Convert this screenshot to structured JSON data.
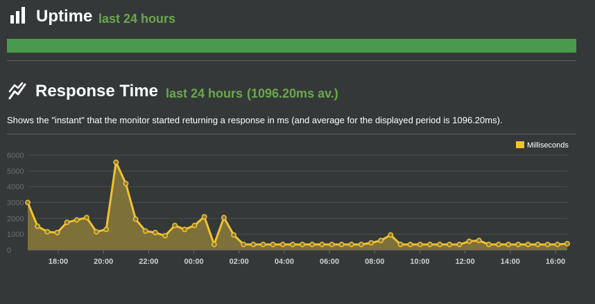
{
  "uptime": {
    "title": "Uptime",
    "period": "last 24 hours",
    "bar_color": "#4a9a4d",
    "icon": "bar-chart-icon"
  },
  "response": {
    "title": "Response Time",
    "period": "last 24 hours",
    "average": "(1096.20ms av.)",
    "description": "Shows the \"instant\" that the monitor started returning a response in ms (and average for the displayed period is 1096.20ms).",
    "icon": "line-chart-icon"
  },
  "colors": {
    "background": "#353838",
    "accent": "#6aa84f",
    "line": "#f1c232",
    "fill": "#8a7a3a"
  },
  "chart_data": {
    "type": "area",
    "xlabel": "",
    "ylabel": "",
    "ylim": [
      0,
      6000
    ],
    "y_ticks": [
      "0",
      "1000",
      "2000",
      "3000",
      "4000",
      "5000",
      "6000"
    ],
    "x_ticks": [
      "18:00",
      "20:00",
      "22:00",
      "00:00",
      "02:00",
      "04:00",
      "06:00",
      "08:00",
      "10:00",
      "12:00",
      "14:00",
      "16:00"
    ],
    "grid": true,
    "legend_position": "top-right",
    "series": [
      {
        "name": "Milliseconds",
        "color": "#f1c232",
        "values": [
          3000,
          1500,
          1150,
          1100,
          1750,
          1900,
          2050,
          1150,
          1300,
          5550,
          4200,
          1950,
          1200,
          1100,
          900,
          1550,
          1300,
          1550,
          2100,
          350,
          2050,
          950,
          350,
          350,
          350,
          350,
          350,
          350,
          350,
          350,
          350,
          350,
          350,
          350,
          350,
          450,
          600,
          950,
          350,
          350,
          350,
          350,
          350,
          350,
          350,
          550,
          600,
          350,
          350,
          350,
          350,
          350,
          350,
          350,
          350,
          400
        ]
      }
    ]
  }
}
